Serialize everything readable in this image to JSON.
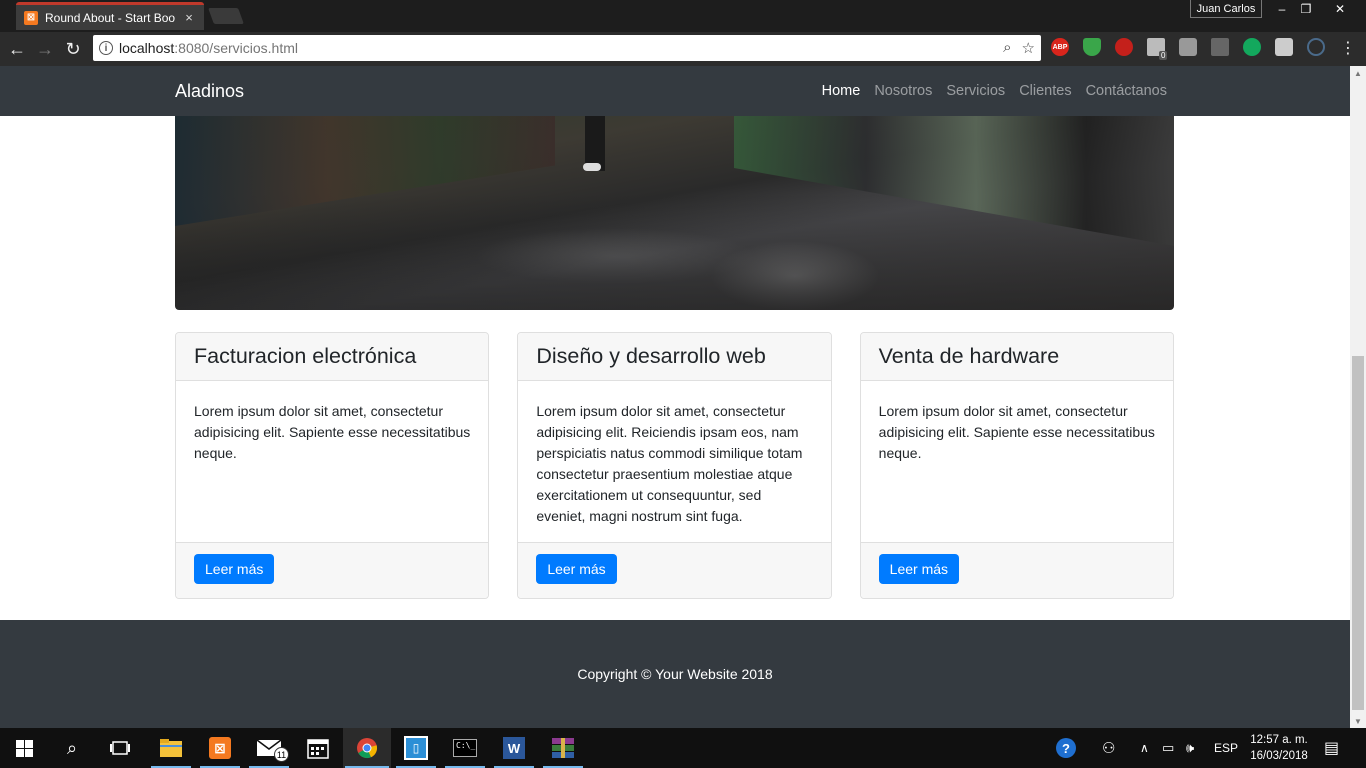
{
  "browser": {
    "tab_title": "Round About - Start Boo",
    "tab_close": "×",
    "profile_name": "Juan Carlos",
    "url_host": "localhost",
    "url_path": ":8080/servicios.html",
    "minimize": "–",
    "maximize": "❐",
    "close": "✕",
    "ext_abp": "ABP",
    "ext_badge": "0"
  },
  "site": {
    "brand": "Aladinos",
    "nav": [
      "Home",
      "Nosotros",
      "Servicios",
      "Clientes",
      "Contáctanos"
    ],
    "cards": [
      {
        "title": "Facturacion electrónica",
        "text": "Lorem ipsum dolor sit amet, consectetur adipisicing elit. Sapiente esse necessitatibus neque.",
        "button": "Leer más"
      },
      {
        "title": "Diseño y desarrollo web",
        "text": "Lorem ipsum dolor sit amet, consectetur adipisicing elit. Reiciendis ipsam eos, nam perspiciatis natus commodi similique totam consectetur praesentium molestiae atque exercitationem ut consequuntur, sed eveniet, magni nostrum sint fuga.",
        "button": "Leer más"
      },
      {
        "title": "Venta de hardware",
        "text": "Lorem ipsum dolor sit amet, consectetur adipisicing elit. Sapiente esse necessitatibus neque.",
        "button": "Leer más"
      }
    ],
    "footer": "Copyright © Your Website 2018"
  },
  "taskbar": {
    "mail_badge": "11",
    "language": "ESP",
    "time": "12:57 a. m.",
    "date": "16/03/2018"
  }
}
